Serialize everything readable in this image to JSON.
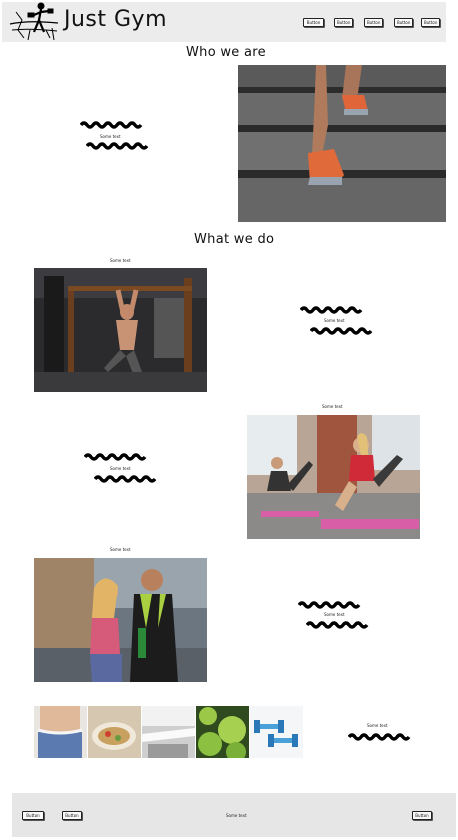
{
  "header": {
    "brand": "Just Gym",
    "buttons": [
      "Button",
      "Button",
      "Button",
      "Button",
      "Button"
    ]
  },
  "who": {
    "title": "Who we are",
    "caption": "Some text"
  },
  "what": {
    "title": "What we do",
    "items": [
      {
        "caption_top": "Some text",
        "caption_side": "Some text"
      },
      {
        "caption_top": "Some text",
        "caption_side": "Some text"
      },
      {
        "caption_top": "Some text",
        "caption_side": "Some text"
      }
    ]
  },
  "gallery": {
    "caption": "Some text"
  },
  "footer": {
    "buttons": [
      "Button",
      "Button",
      "Button"
    ],
    "text": "Some text"
  },
  "colors": {
    "header_bg": "#ececec",
    "footer_bg": "#e6e6e6"
  }
}
